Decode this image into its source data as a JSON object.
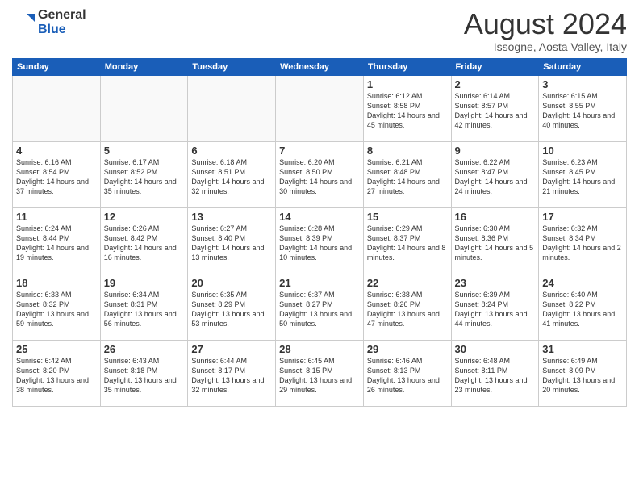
{
  "logo": {
    "general": "General",
    "blue": "Blue"
  },
  "header": {
    "title": "August 2024",
    "location": "Issogne, Aosta Valley, Italy"
  },
  "days_of_week": [
    "Sunday",
    "Monday",
    "Tuesday",
    "Wednesday",
    "Thursday",
    "Friday",
    "Saturday"
  ],
  "weeks": [
    [
      {
        "day": "",
        "info": ""
      },
      {
        "day": "",
        "info": ""
      },
      {
        "day": "",
        "info": ""
      },
      {
        "day": "",
        "info": ""
      },
      {
        "day": "1",
        "info": "Sunrise: 6:12 AM\nSunset: 8:58 PM\nDaylight: 14 hours and 45 minutes."
      },
      {
        "day": "2",
        "info": "Sunrise: 6:14 AM\nSunset: 8:57 PM\nDaylight: 14 hours and 42 minutes."
      },
      {
        "day": "3",
        "info": "Sunrise: 6:15 AM\nSunset: 8:55 PM\nDaylight: 14 hours and 40 minutes."
      }
    ],
    [
      {
        "day": "4",
        "info": "Sunrise: 6:16 AM\nSunset: 8:54 PM\nDaylight: 14 hours and 37 minutes."
      },
      {
        "day": "5",
        "info": "Sunrise: 6:17 AM\nSunset: 8:52 PM\nDaylight: 14 hours and 35 minutes."
      },
      {
        "day": "6",
        "info": "Sunrise: 6:18 AM\nSunset: 8:51 PM\nDaylight: 14 hours and 32 minutes."
      },
      {
        "day": "7",
        "info": "Sunrise: 6:20 AM\nSunset: 8:50 PM\nDaylight: 14 hours and 30 minutes."
      },
      {
        "day": "8",
        "info": "Sunrise: 6:21 AM\nSunset: 8:48 PM\nDaylight: 14 hours and 27 minutes."
      },
      {
        "day": "9",
        "info": "Sunrise: 6:22 AM\nSunset: 8:47 PM\nDaylight: 14 hours and 24 minutes."
      },
      {
        "day": "10",
        "info": "Sunrise: 6:23 AM\nSunset: 8:45 PM\nDaylight: 14 hours and 21 minutes."
      }
    ],
    [
      {
        "day": "11",
        "info": "Sunrise: 6:24 AM\nSunset: 8:44 PM\nDaylight: 14 hours and 19 minutes."
      },
      {
        "day": "12",
        "info": "Sunrise: 6:26 AM\nSunset: 8:42 PM\nDaylight: 14 hours and 16 minutes."
      },
      {
        "day": "13",
        "info": "Sunrise: 6:27 AM\nSunset: 8:40 PM\nDaylight: 14 hours and 13 minutes."
      },
      {
        "day": "14",
        "info": "Sunrise: 6:28 AM\nSunset: 8:39 PM\nDaylight: 14 hours and 10 minutes."
      },
      {
        "day": "15",
        "info": "Sunrise: 6:29 AM\nSunset: 8:37 PM\nDaylight: 14 hours and 8 minutes."
      },
      {
        "day": "16",
        "info": "Sunrise: 6:30 AM\nSunset: 8:36 PM\nDaylight: 14 hours and 5 minutes."
      },
      {
        "day": "17",
        "info": "Sunrise: 6:32 AM\nSunset: 8:34 PM\nDaylight: 14 hours and 2 minutes."
      }
    ],
    [
      {
        "day": "18",
        "info": "Sunrise: 6:33 AM\nSunset: 8:32 PM\nDaylight: 13 hours and 59 minutes."
      },
      {
        "day": "19",
        "info": "Sunrise: 6:34 AM\nSunset: 8:31 PM\nDaylight: 13 hours and 56 minutes."
      },
      {
        "day": "20",
        "info": "Sunrise: 6:35 AM\nSunset: 8:29 PM\nDaylight: 13 hours and 53 minutes."
      },
      {
        "day": "21",
        "info": "Sunrise: 6:37 AM\nSunset: 8:27 PM\nDaylight: 13 hours and 50 minutes."
      },
      {
        "day": "22",
        "info": "Sunrise: 6:38 AM\nSunset: 8:26 PM\nDaylight: 13 hours and 47 minutes."
      },
      {
        "day": "23",
        "info": "Sunrise: 6:39 AM\nSunset: 8:24 PM\nDaylight: 13 hours and 44 minutes."
      },
      {
        "day": "24",
        "info": "Sunrise: 6:40 AM\nSunset: 8:22 PM\nDaylight: 13 hours and 41 minutes."
      }
    ],
    [
      {
        "day": "25",
        "info": "Sunrise: 6:42 AM\nSunset: 8:20 PM\nDaylight: 13 hours and 38 minutes."
      },
      {
        "day": "26",
        "info": "Sunrise: 6:43 AM\nSunset: 8:18 PM\nDaylight: 13 hours and 35 minutes."
      },
      {
        "day": "27",
        "info": "Sunrise: 6:44 AM\nSunset: 8:17 PM\nDaylight: 13 hours and 32 minutes."
      },
      {
        "day": "28",
        "info": "Sunrise: 6:45 AM\nSunset: 8:15 PM\nDaylight: 13 hours and 29 minutes."
      },
      {
        "day": "29",
        "info": "Sunrise: 6:46 AM\nSunset: 8:13 PM\nDaylight: 13 hours and 26 minutes."
      },
      {
        "day": "30",
        "info": "Sunrise: 6:48 AM\nSunset: 8:11 PM\nDaylight: 13 hours and 23 minutes."
      },
      {
        "day": "31",
        "info": "Sunrise: 6:49 AM\nSunset: 8:09 PM\nDaylight: 13 hours and 20 minutes."
      }
    ]
  ]
}
